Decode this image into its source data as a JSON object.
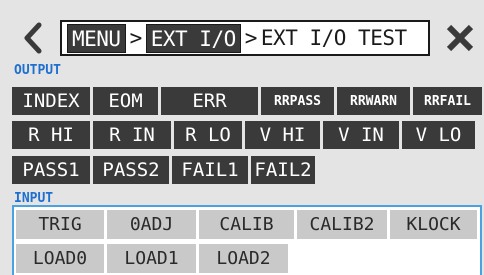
{
  "header": {
    "back_icon": "chevron-left-icon",
    "close_icon": "close-icon",
    "breadcrumb": {
      "menu": "MENU",
      "separator": ">",
      "ext_io": "EXT I/O",
      "current": "EXT I/O TEST"
    }
  },
  "output": {
    "label": "OUTPUT",
    "rows": [
      [
        "INDEX",
        "EOM",
        "ERR",
        "RRPASS",
        "RRWARN",
        "RRFAIL"
      ],
      [
        "R HI",
        "R IN",
        "R LO",
        "V HI",
        "V IN",
        "V LO"
      ],
      [
        "PASS1",
        "PASS2",
        "FAIL1",
        "FAIL2"
      ]
    ]
  },
  "input": {
    "label": "INPUT",
    "rows": [
      [
        "TRIG",
        "0ADJ",
        "CALIB",
        "CALIB2",
        "KLOCK"
      ],
      [
        "LOAD0",
        "LOAD1",
        "LOAD2"
      ]
    ]
  },
  "colors": {
    "background": "#e4e4e4",
    "output_button": "#3a3a3a",
    "input_button": "#c9c9c9",
    "section_label": "#1e6fd0",
    "input_panel_border": "#4aa3e0"
  }
}
